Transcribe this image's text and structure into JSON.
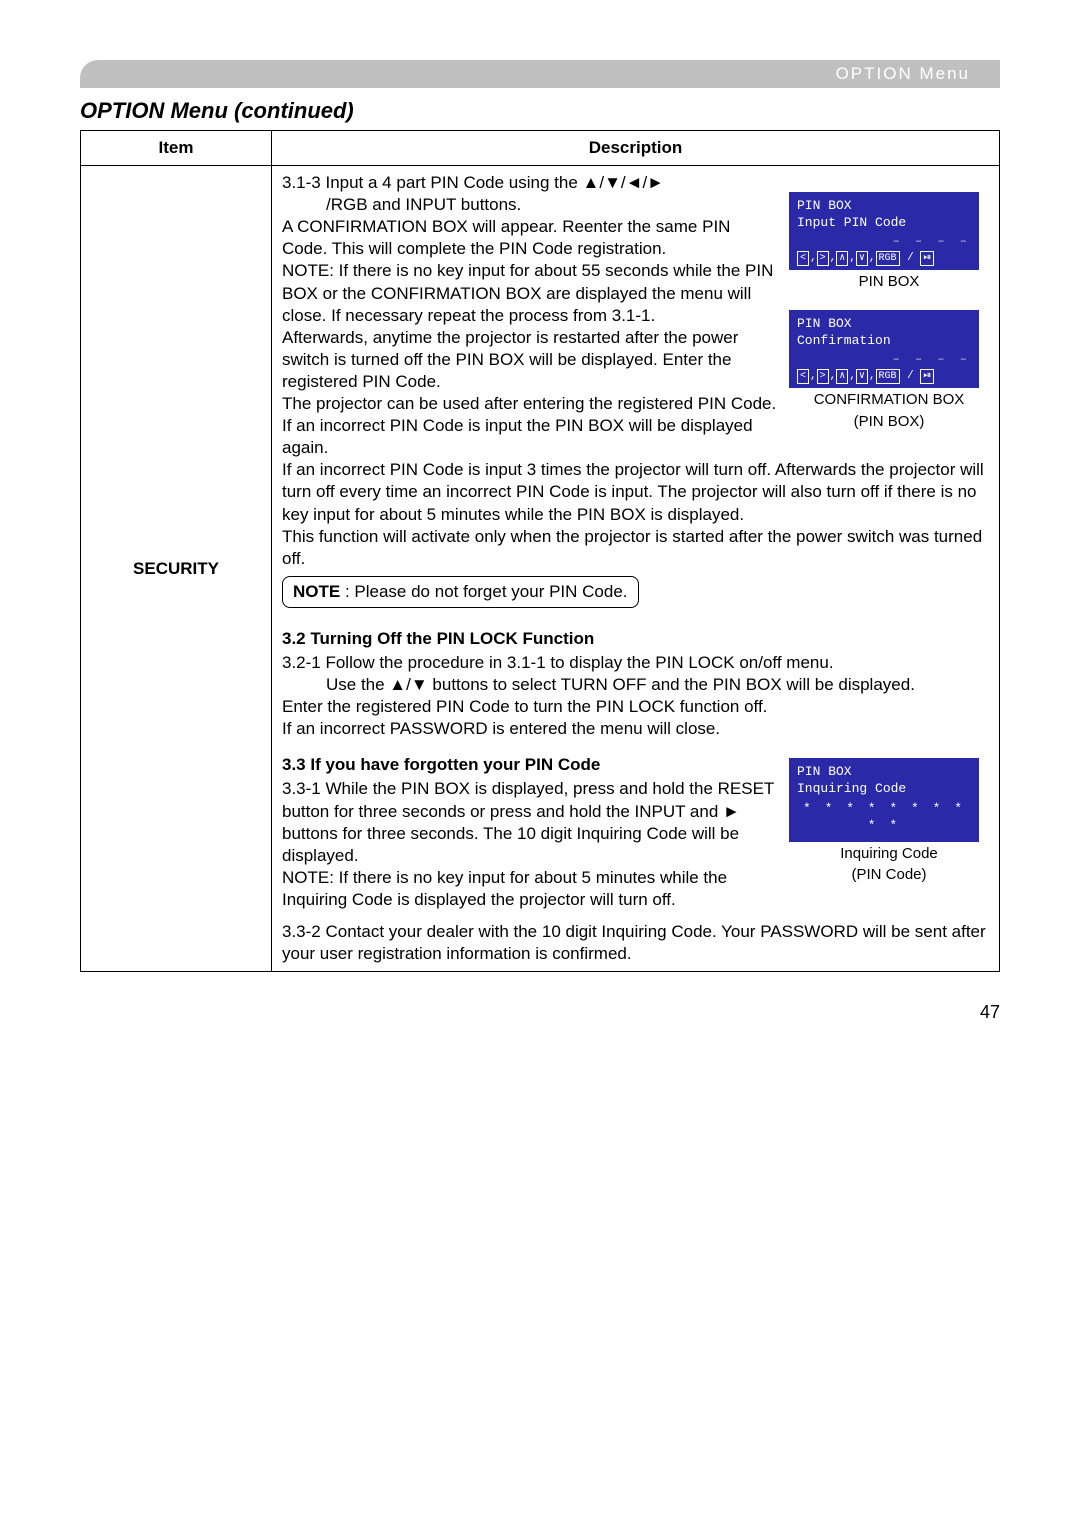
{
  "header_tab": "OPTION Menu",
  "section_title": "OPTION Menu (continued)",
  "table": {
    "header_item": "Item",
    "header_desc": "Description",
    "item_label": "SECURITY"
  },
  "body": {
    "p313_lead": "3.1-3  Input a 4 part PIN Code using the ▲/▼/◄/►",
    "p313_line2": "/RGB and INPUT buttons.",
    "p313_a": "A CONFIRMATION BOX will appear. Reenter the same PIN Code. This will complete the PIN Code registration.",
    "p313_note1": "NOTE: If there is no key input for about 55 seconds while the PIN BOX or the CONFIRMATION BOX are displayed the menu will close. If necessary repeat the process from 3.1-1.",
    "p313_b": "Afterwards, anytime the projector is restarted after the power switch is turned off the PIN BOX will be displayed. Enter the registered PIN Code.",
    "p313_c": "The projector can be used after entering the registered PIN Code. If an incorrect PIN Code is input the PIN BOX will be displayed again.",
    "p313_d": "If an incorrect PIN Code is input 3 times the projector will turn off. Afterwards the projector will turn off every time an incorrect PIN Code is input. The projector will also turn off if there is no key input for about 5 minutes while the PIN BOX is displayed.",
    "p313_e": "This function will activate only when the projector is started after the power switch was turned off.",
    "note_box_label": "NOTE",
    "note_box_text": " : Please do not forget your PIN Code.",
    "h32": "3.2 Turning Off the PIN LOCK Function",
    "p321_a": "3.2-1 Follow the procedure in 3.1-1 to display the PIN LOCK on/off menu.",
    "p321_b": "Use the ▲/▼ buttons to select TURN OFF and the PIN BOX will be displayed.",
    "p321_c": "Enter the registered PIN Code to turn the PIN LOCK function off.",
    "p321_d": "If an incorrect PASSWORD is entered the  menu will close.",
    "h33": "3.3 If you have forgotten your PIN Code",
    "p331_a": "3.3-1 While the PIN BOX is displayed, press and hold the RESET button for three seconds or press and hold the INPUT and ► buttons for three seconds. The 10 digit Inquiring Code will be displayed.",
    "p331_note": "NOTE: If there is no key input for about 5 minutes while the Inquiring Code is displayed the projector will turn off.",
    "p332": "3.3-2 Contact your dealer with the 10 digit Inquiring Code. Your PASSWORD will be sent after your user registration information is confirmed."
  },
  "dialogs": {
    "pin_title": "PIN BOX",
    "pin_sub": "Input PIN Code",
    "dashes": "– – – –",
    "keys_html": "[<] , [>] , [∧] , [∨] , [RGB] / ⏯",
    "pin_caption": "PIN BOX",
    "conf_title": "PIN BOX",
    "conf_sub": "Confirmation",
    "conf_caption1": "CONFIRMATION BOX",
    "conf_caption2": "(PIN BOX)",
    "inq_title": "PIN BOX",
    "inq_sub": "Inquiring Code",
    "inq_stars": "* *  * * * *  * * * *",
    "inq_caption1": "Inquiring Code",
    "inq_caption2": "(PIN Code)"
  },
  "page_number": "47"
}
